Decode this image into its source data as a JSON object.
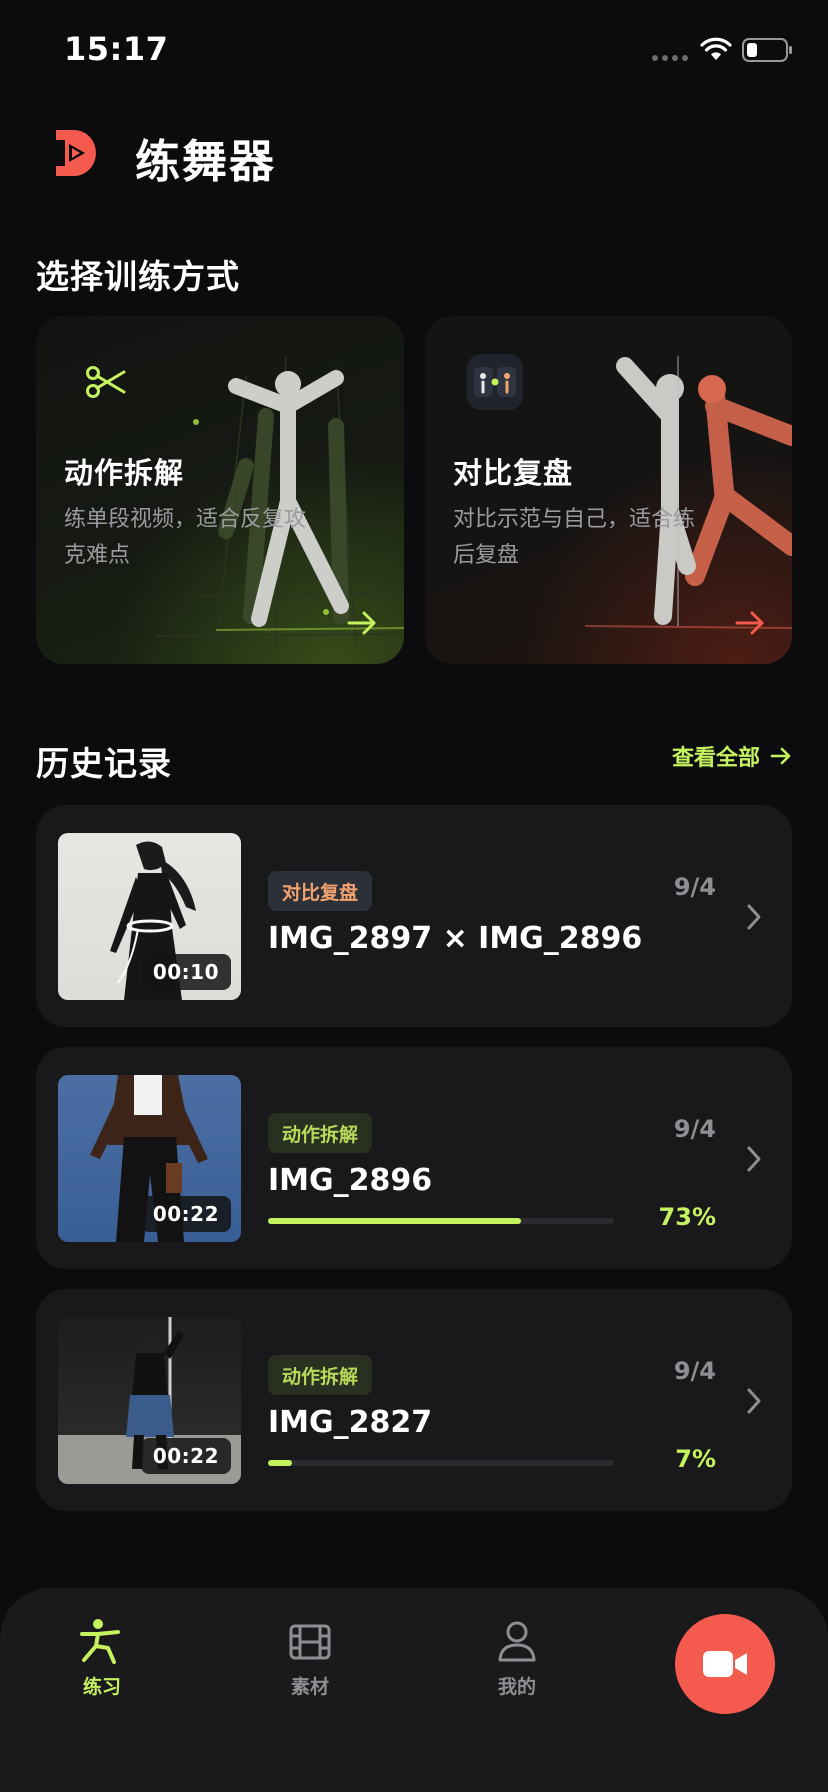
{
  "status_bar": {
    "time": "15:17"
  },
  "header": {
    "title": "练舞器",
    "logo": "dance-logo-icon"
  },
  "modes": {
    "section_title": "选择训练方式",
    "items": [
      {
        "name": "动作拆解",
        "desc": "练单段视频，适合反复攻克难点",
        "icon": "scissors-icon",
        "accent": "#c5f25f"
      },
      {
        "name": "对比复盘",
        "desc": "对比示范与自己，适合练后复盘",
        "icon": "compare-icon",
        "accent": "#f45a4d"
      }
    ]
  },
  "history": {
    "section_title": "历史记录",
    "view_all": "查看全部",
    "items": [
      {
        "tag": "对比复盘",
        "date": "9/4",
        "name": "IMG_2897 × IMG_2896",
        "duration": "00:10"
      },
      {
        "tag": "动作拆解",
        "date": "9/4",
        "name": "IMG_2896",
        "duration": "00:22",
        "progress": 0.73,
        "progress_text": "73%"
      },
      {
        "tag": "动作拆解",
        "date": "9/4",
        "name": "IMG_2827",
        "duration": "00:22",
        "progress": 0.07,
        "progress_text": "7%"
      }
    ]
  },
  "tab_bar": {
    "tabs": [
      {
        "label": "练习",
        "icon": "dancer-icon",
        "active": true
      },
      {
        "label": "素材",
        "icon": "film-icon",
        "active": false
      },
      {
        "label": "我的",
        "icon": "person-icon",
        "active": false
      }
    ],
    "record_icon": "video-camera-icon"
  },
  "colors": {
    "accent_green": "#c5f25f",
    "accent_red": "#f45a4d",
    "tag_orange": "#f4a36f"
  }
}
